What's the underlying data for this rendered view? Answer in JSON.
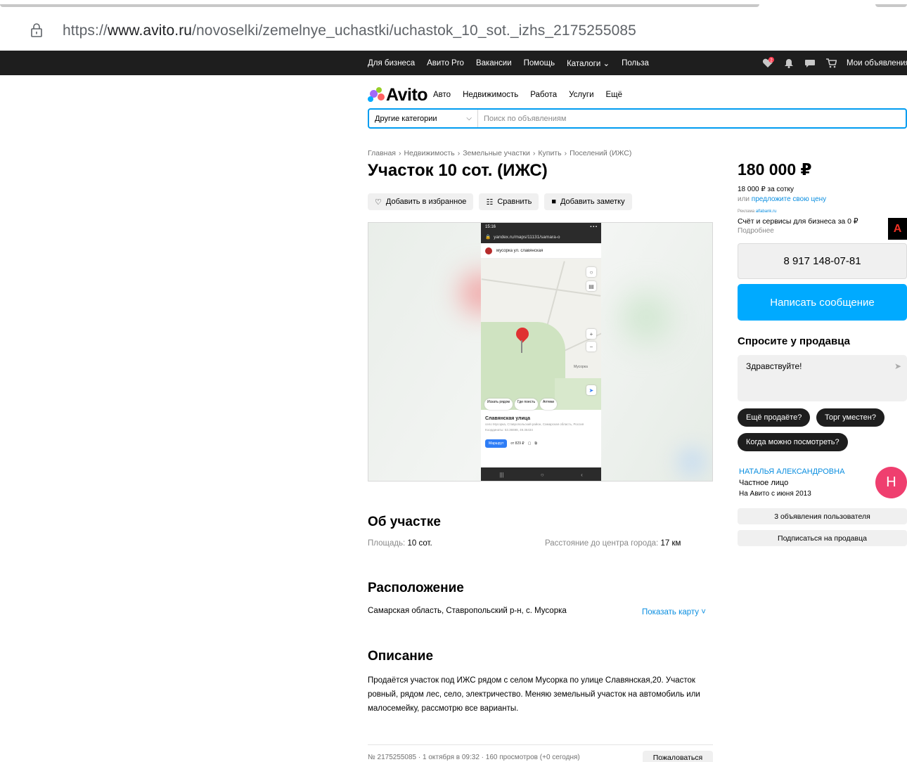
{
  "browser": {
    "url_prefix": "https://",
    "url_domain": "www.avito.ru",
    "url_path": "/novoselki/zemelnye_uchastki/uchastok_10_sot._izhs_2175255085"
  },
  "topbar": {
    "links": [
      "Для бизнеса",
      "Авито Pro",
      "Вакансии",
      "Помощь",
      "Каталоги",
      "Польза"
    ],
    "catalogs_caret": "⌄",
    "my_ads": "Мои объявления",
    "badge": "2"
  },
  "header": {
    "logo": "Avito",
    "categories": [
      "Авто",
      "Недвижимость",
      "Работа",
      "Услуги",
      "Ещё"
    ],
    "search_category": "Другие категории",
    "search_placeholder": "Поиск по объявлениям"
  },
  "breadcrumbs": [
    "Главная",
    "Недвижимость",
    "Земельные участки",
    "Купить",
    "Поселений (ИЖС)"
  ],
  "breadcrumb_sep": "›",
  "title": "Участок 10 сот. (ИЖС)",
  "actions": {
    "favorite": "Добавить в избранное",
    "compare": "Сравнить",
    "note": "Добавить заметку"
  },
  "photo": {
    "status_time": "15:16",
    "address": "yandex.ru/maps/11131/samara-o",
    "place_name": "мусорка ул. славянская",
    "map_label": "Мусорка",
    "chips": [
      "Искать рядом",
      "Где поесть",
      "Аптеки"
    ],
    "card_title": "Славянская улица",
    "card_sub": "село Мусорка, Ставропольский район, Самарская область, Россия",
    "card_coords": "Координаты: 53.36598, 49.36434",
    "route_btn": "Маршрут",
    "taxi_btn": "от 829 ₽"
  },
  "about": {
    "heading": "Об участке",
    "area_label": "Площадь:",
    "area_value": "10 сот.",
    "distance_label": "Расстояние до центра города:",
    "distance_value": "17 км"
  },
  "location": {
    "heading": "Расположение",
    "address": "Самарская область, Ставропольский р-н, с. Мусорка",
    "show_map": "Показать карту ˅"
  },
  "description": {
    "heading": "Описание",
    "text": "Продаётся участок под ИЖС рядом с селом Мусорка по улице Славянская,20. Участок ровный, рядом лес, село, электричество. Меняю земельный участок на автомобиль или малосемейку, рассмотрю все варианты."
  },
  "footer": {
    "meta": "№ 2175255085 · 1 октября в 09:32 · 160 просмотров (+0 сегодня)",
    "report": "Пожаловаться"
  },
  "sidebar": {
    "price": "180 000 ₽",
    "per_unit": "18 000 ₽ за сотку",
    "offer_prefix": "или",
    "offer_link": "предложите свою цену",
    "ad_label": "Реклама",
    "ad_domain": "alfabank.ru",
    "ad_text": "Счёт и сервисы для бизнеса за 0 ₽",
    "ad_more": "Подробнее",
    "ad_logo": "A",
    "phone": "8 917 148-07-81",
    "message_button": "Написать сообщение",
    "ask_title": "Спросите у продавца",
    "ask_text": "Здравствуйте!",
    "quick_questions": [
      "Ещё продаёте?",
      "Торг уместен?",
      "Когда можно посмотреть?"
    ],
    "seller_name": "НАТАЛЬЯ АЛЕКСАНДРОВНА",
    "seller_type": "Частное лицо",
    "seller_since": "На Авито с июня 2013",
    "avatar_letter": "Н",
    "user_ads": "3 объявления пользователя",
    "subscribe": "Подписаться на продавца"
  }
}
